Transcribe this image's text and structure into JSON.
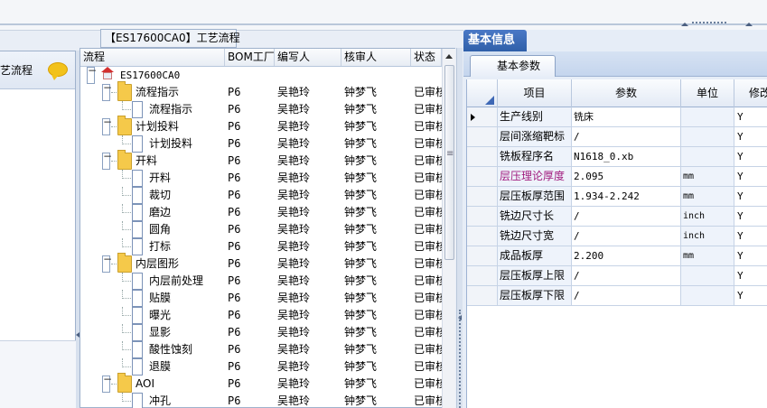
{
  "left_panel": {
    "title": "艺流程",
    "chat_icon": "speech-bubble-icon"
  },
  "tree_panel": {
    "title": "【ES17600CA0】工艺流程",
    "columns": [
      "流程",
      "BOM工厂",
      "编写人",
      "核审人",
      "状态"
    ],
    "rows": [
      {
        "label": "ES17600CA0",
        "type": "root",
        "bom": "",
        "writer": "",
        "reviewer": "",
        "state": ""
      },
      {
        "label": "流程指示",
        "type": "folder",
        "bom": "P6",
        "writer": "吴艳玲",
        "reviewer": "钟梦飞",
        "state": "已审核"
      },
      {
        "label": "流程指示",
        "type": "file",
        "bom": "P6",
        "writer": "吴艳玲",
        "reviewer": "钟梦飞",
        "state": "已审核"
      },
      {
        "label": "计划投料",
        "type": "folder",
        "bom": "P6",
        "writer": "吴艳玲",
        "reviewer": "钟梦飞",
        "state": "已审核"
      },
      {
        "label": "计划投料",
        "type": "file",
        "bom": "P6",
        "writer": "吴艳玲",
        "reviewer": "钟梦飞",
        "state": "已审核"
      },
      {
        "label": "开料",
        "type": "folder",
        "bom": "P6",
        "writer": "吴艳玲",
        "reviewer": "钟梦飞",
        "state": "已审核"
      },
      {
        "label": "开料",
        "type": "file",
        "bom": "P6",
        "writer": "吴艳玲",
        "reviewer": "钟梦飞",
        "state": "已审核"
      },
      {
        "label": "裁切",
        "type": "file",
        "bom": "P6",
        "writer": "吴艳玲",
        "reviewer": "钟梦飞",
        "state": "已审核"
      },
      {
        "label": "磨边",
        "type": "file",
        "bom": "P6",
        "writer": "吴艳玲",
        "reviewer": "钟梦飞",
        "state": "已审核"
      },
      {
        "label": "圆角",
        "type": "file",
        "bom": "P6",
        "writer": "吴艳玲",
        "reviewer": "钟梦飞",
        "state": "已审核"
      },
      {
        "label": "打标",
        "type": "file",
        "bom": "P6",
        "writer": "吴艳玲",
        "reviewer": "钟梦飞",
        "state": "已审核"
      },
      {
        "label": "内层图形",
        "type": "folder",
        "bom": "P6",
        "writer": "吴艳玲",
        "reviewer": "钟梦飞",
        "state": "已审核"
      },
      {
        "label": "内层前处理",
        "type": "file",
        "bom": "P6",
        "writer": "吴艳玲",
        "reviewer": "钟梦飞",
        "state": "已审核"
      },
      {
        "label": "贴膜",
        "type": "file",
        "bom": "P6",
        "writer": "吴艳玲",
        "reviewer": "钟梦飞",
        "state": "已审核"
      },
      {
        "label": "曝光",
        "type": "file",
        "bom": "P6",
        "writer": "吴艳玲",
        "reviewer": "钟梦飞",
        "state": "已审核"
      },
      {
        "label": "显影",
        "type": "file",
        "bom": "P6",
        "writer": "吴艳玲",
        "reviewer": "钟梦飞",
        "state": "已审核"
      },
      {
        "label": "酸性蚀刻",
        "type": "file",
        "bom": "P6",
        "writer": "吴艳玲",
        "reviewer": "钟梦飞",
        "state": "已审核"
      },
      {
        "label": "退膜",
        "type": "file",
        "bom": "P6",
        "writer": "吴艳玲",
        "reviewer": "钟梦飞",
        "state": "已审核"
      },
      {
        "label": "AOI",
        "type": "folder",
        "bom": "P6",
        "writer": "吴艳玲",
        "reviewer": "钟梦飞",
        "state": "已审核"
      },
      {
        "label": "冲孔",
        "type": "file",
        "bom": "P6",
        "writer": "吴艳玲",
        "reviewer": "钟梦飞",
        "state": "已审核"
      }
    ]
  },
  "right_panel": {
    "tab": "基本信息",
    "subtab": "基本参数",
    "columns": [
      "项目",
      "参数",
      "单位",
      "修改"
    ],
    "rows": [
      {
        "item": "生产线别",
        "param": "铣床",
        "unit": "",
        "modify": "Y",
        "current": true
      },
      {
        "item": "层间涨缩靶标",
        "param": "/",
        "unit": "",
        "modify": "Y"
      },
      {
        "item": "铣板程序名",
        "param": "N1618_0.xb",
        "unit": "",
        "modify": "Y"
      },
      {
        "item": "层压理论厚度",
        "param": "2.095",
        "unit": "mm",
        "modify": "Y",
        "highlight": true
      },
      {
        "item": "层压板厚范围",
        "param": "1.934-2.242",
        "unit": "mm",
        "modify": "Y"
      },
      {
        "item": "铣边尺寸长",
        "param": "/",
        "unit": "inch",
        "modify": "Y"
      },
      {
        "item": "铣边尺寸宽",
        "param": "/",
        "unit": "inch",
        "modify": "Y"
      },
      {
        "item": "成品板厚",
        "param": "2.200",
        "unit": "mm",
        "modify": "Y"
      },
      {
        "item": "层压板厚上限",
        "param": "/",
        "unit": "",
        "modify": "Y"
      },
      {
        "item": "层压板厚下限",
        "param": "/",
        "unit": "",
        "modify": "Y"
      }
    ]
  },
  "colors": {
    "accent": "#2f5fa9",
    "highlight_text": "#a01a7d",
    "border": "#9fb2cc"
  }
}
